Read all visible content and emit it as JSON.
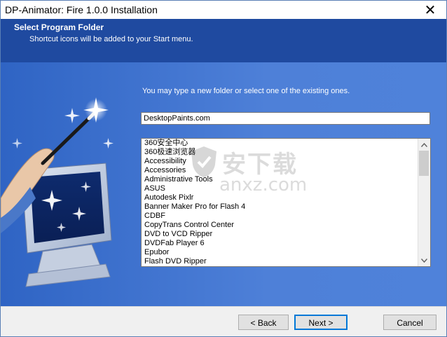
{
  "window": {
    "title": "DP-Animator: Fire 1.0.0 Installation",
    "close_glyph": "✕"
  },
  "header": {
    "title": "Select Program Folder",
    "subtitle": "Shortcut icons will be added to your Start menu."
  },
  "main": {
    "instruction": "You may type a new folder or select one of the existing ones.",
    "folder_value": "DesktopPaints.com",
    "existing_folders": [
      "360安全中心",
      "360极速浏览器",
      "Accessibility",
      "Accessories",
      "Administrative Tools",
      "ASUS",
      "Autodesk Pixlr",
      "Banner Maker Pro for Flash 4",
      "CDBF",
      "CopyTrans Control Center",
      "DVD to VCD Ripper",
      "DVDFab Player 6",
      "Epubor",
      "Flash DVD Ripper"
    ]
  },
  "watermark": {
    "cn": "安下载",
    "url": "anxz.com"
  },
  "footer": {
    "back_label": "< Back",
    "next_label": "Next >",
    "cancel_label": "Cancel"
  },
  "colors": {
    "header_bg": "#1f4aa0",
    "panel_bg": "#3d70cc",
    "focus_border": "#0078d7"
  }
}
